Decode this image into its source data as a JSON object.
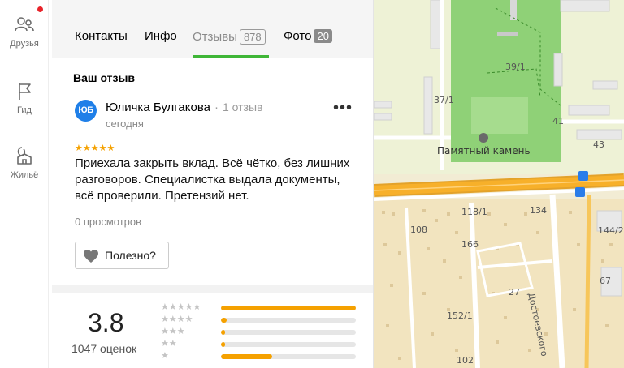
{
  "sidebar": {
    "items": [
      {
        "label": "Друзья",
        "icon": "friends-icon",
        "has_notification": true
      },
      {
        "label": "Гид",
        "icon": "flag-icon"
      },
      {
        "label": "Жильё",
        "icon": "housing-icon"
      }
    ]
  },
  "tabs": [
    {
      "label": "Контакты"
    },
    {
      "label": "Инфо"
    },
    {
      "label": "Отзывы",
      "count": "878",
      "active": true
    },
    {
      "label": "Фото",
      "count": "20"
    }
  ],
  "review": {
    "section_title": "Ваш отзыв",
    "avatar_initials": "ЮБ",
    "author": "Юличка Булгакова",
    "author_separator": "·",
    "author_reviews": "1 отзыв",
    "date": "сегодня",
    "menu": "•••",
    "stars": "★★★★★",
    "rating": 5,
    "text": "Приехала закрыть вклад. Всё чётко, без лишних разговоров. Специалистка выдала документы, всё проверили. Претензий нет.",
    "views": "0 просмотров",
    "useful_button": "Полезно?"
  },
  "summary": {
    "rating": "3.8",
    "count_label": "1047 оценок",
    "distribution": [
      {
        "stars": 5,
        "stars_label": "★★★★★",
        "fraction": 1.0
      },
      {
        "stars": 4,
        "stars_label": "★★★★",
        "fraction": 0.04
      },
      {
        "stars": 3,
        "stars_label": "★★★",
        "fraction": 0.03
      },
      {
        "stars": 2,
        "stars_label": "★★",
        "fraction": 0.03
      },
      {
        "stars": 1,
        "stars_label": "★",
        "fraction": 0.38
      }
    ]
  },
  "map": {
    "labels": {
      "b39_1": "39/1",
      "b37_1": "37/1",
      "b41": "41",
      "b43": "43",
      "landmark": "Памятный камень",
      "b118_1": "118/1",
      "b134": "134",
      "b108": "108",
      "b166": "166",
      "b144_2": "144/2",
      "b27": "27",
      "b67": "67",
      "b152_1": "152/1",
      "b102": "102",
      "street": "Достоевского"
    },
    "colors": {
      "park": "#8fd177",
      "road": "#f7b02a",
      "background": "#f2ecd4",
      "block": "#e6f0c8"
    }
  }
}
